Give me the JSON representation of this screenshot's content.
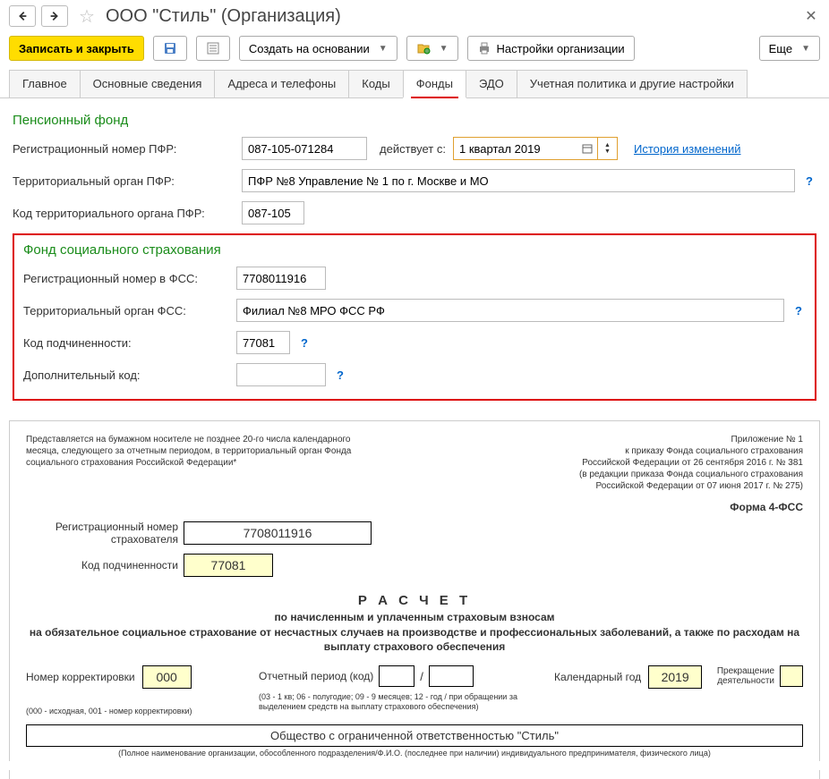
{
  "header": {
    "title": "ООО \"Стиль\" (Организация)"
  },
  "toolbar": {
    "save_close": "Записать и закрыть",
    "create_based": "Создать на основании",
    "org_settings": "Настройки организации",
    "more": "Еще"
  },
  "tabs": [
    "Главное",
    "Основные сведения",
    "Адреса и телефоны",
    "Коды",
    "Фонды",
    "ЭДО",
    "Учетная политика и другие настройки"
  ],
  "active_tab": 4,
  "pfr": {
    "title": "Пенсионный фонд",
    "reg_label": "Регистрационный номер ПФР:",
    "reg_value": "087-105-071284",
    "effective_label": "действует с:",
    "effective_value": "1 квартал 2019",
    "history_link": "История изменений",
    "terr_label": "Территориальный орган ПФР:",
    "terr_value": "ПФР №8 Управление № 1 по г. Москве и МО",
    "code_label": "Код территориального органа ПФР:",
    "code_value": "087-105"
  },
  "fss": {
    "title": "Фонд социального страхования",
    "reg_label": "Регистрационный номер в ФСС:",
    "reg_value": "7708011916",
    "terr_label": "Территориальный орган ФСС:",
    "terr_value": "Филиал №8 МРО ФСС РФ",
    "sub_label": "Код подчиненности:",
    "sub_value": "77081",
    "extra_label": "Дополнительный код:",
    "extra_value": ""
  },
  "doc": {
    "appendix": "Приложение № 1\nк приказу Фонда социального страхования\nРоссийской Федерации от 26 сентября 2016 г. № 381\n(в редакции приказа Фонда социального страхования\nРоссийской Федерации от 07 июня 2017 г. № 275)",
    "present_note": "Представляется на бумажном носителе не позднее 20-го числа календарного месяца, следующего за отчетным периодом, в территориальный орган Фонда социального страхования Российской Федерации*",
    "form_name": "Форма 4-ФСС",
    "reg_lbl": "Регистрационный номер страхователя",
    "reg_val": "7708011916",
    "sub_lbl": "Код подчиненности",
    "sub_val": "77081",
    "calc_title": "Р А С Ч Е Т",
    "calc_sub": "по начисленным и уплаченным страховым взносам\nна обязательное социальное страхование от несчастных случаев на производстве и профессиональных заболеваний, а также по расходам на выплату страхового обеспечения",
    "corr_lbl": "Номер корректировки",
    "corr_val": "000",
    "period_lbl": "Отчетный период (код)",
    "period_val1": "",
    "period_val2": "",
    "year_lbl": "Календарный год",
    "year_val": "2019",
    "corr_note": "(000 - исходная, 001 - номер корректировки)",
    "period_note": "(03 - 1 кв; 06 - полугодие; 09 - 9 месяцев; 12 - год / при обращении за выделением средств на выплату страхового обеспечения)",
    "stop_lbl": "Прекращение деятельности",
    "org_fullname": "Общество с ограниченной ответственностью \"Стиль\"",
    "fullname_note": "(Полное наименование организации, обособленного подразделения/Ф.И.О. (последнее при наличии) индивидуального предпринимателя, физического лица)"
  }
}
